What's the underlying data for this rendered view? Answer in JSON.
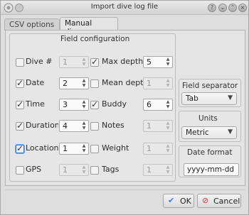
{
  "window": {
    "title": "Import dive log file"
  },
  "tabs": [
    {
      "label": "CSV options"
    },
    {
      "label": "Manual dives"
    }
  ],
  "field_configuration": {
    "title": "Field configuration",
    "left_column": [
      {
        "label": "Dive #",
        "checked": false,
        "value": "1",
        "enabled": false
      },
      {
        "label": "Date",
        "checked": true,
        "value": "2",
        "enabled": true
      },
      {
        "label": "Time",
        "checked": true,
        "value": "3",
        "enabled": true
      },
      {
        "label": "Duration",
        "checked": true,
        "value": "4",
        "enabled": true
      },
      {
        "label": "Location",
        "checked": true,
        "value": "1",
        "enabled": true
      },
      {
        "label": "GPS",
        "checked": false,
        "value": "1",
        "enabled": false
      }
    ],
    "right_column": [
      {
        "label": "Max depth",
        "checked": true,
        "value": "5",
        "enabled": true
      },
      {
        "label": "Mean depth",
        "checked": false,
        "value": "1",
        "enabled": false
      },
      {
        "label": "Buddy",
        "checked": true,
        "value": "6",
        "enabled": true
      },
      {
        "label": "Notes",
        "checked": false,
        "value": "1",
        "enabled": false
      },
      {
        "label": "Weight",
        "checked": false,
        "value": "1",
        "enabled": false
      },
      {
        "label": "Tags",
        "checked": false,
        "value": "1",
        "enabled": false
      }
    ]
  },
  "field_separator": {
    "title": "Field separator",
    "value": "Tab"
  },
  "units": {
    "title": "Units",
    "value": "Metric"
  },
  "date_format": {
    "title": "Date format",
    "value": "yyyy-mm-dd"
  },
  "buttons": {
    "ok": "OK",
    "cancel": "Cancel"
  },
  "colors": {
    "accent": "#3a7bd5",
    "ok_icon": "#3a7bd5",
    "cancel_icon": "#d0342c"
  }
}
